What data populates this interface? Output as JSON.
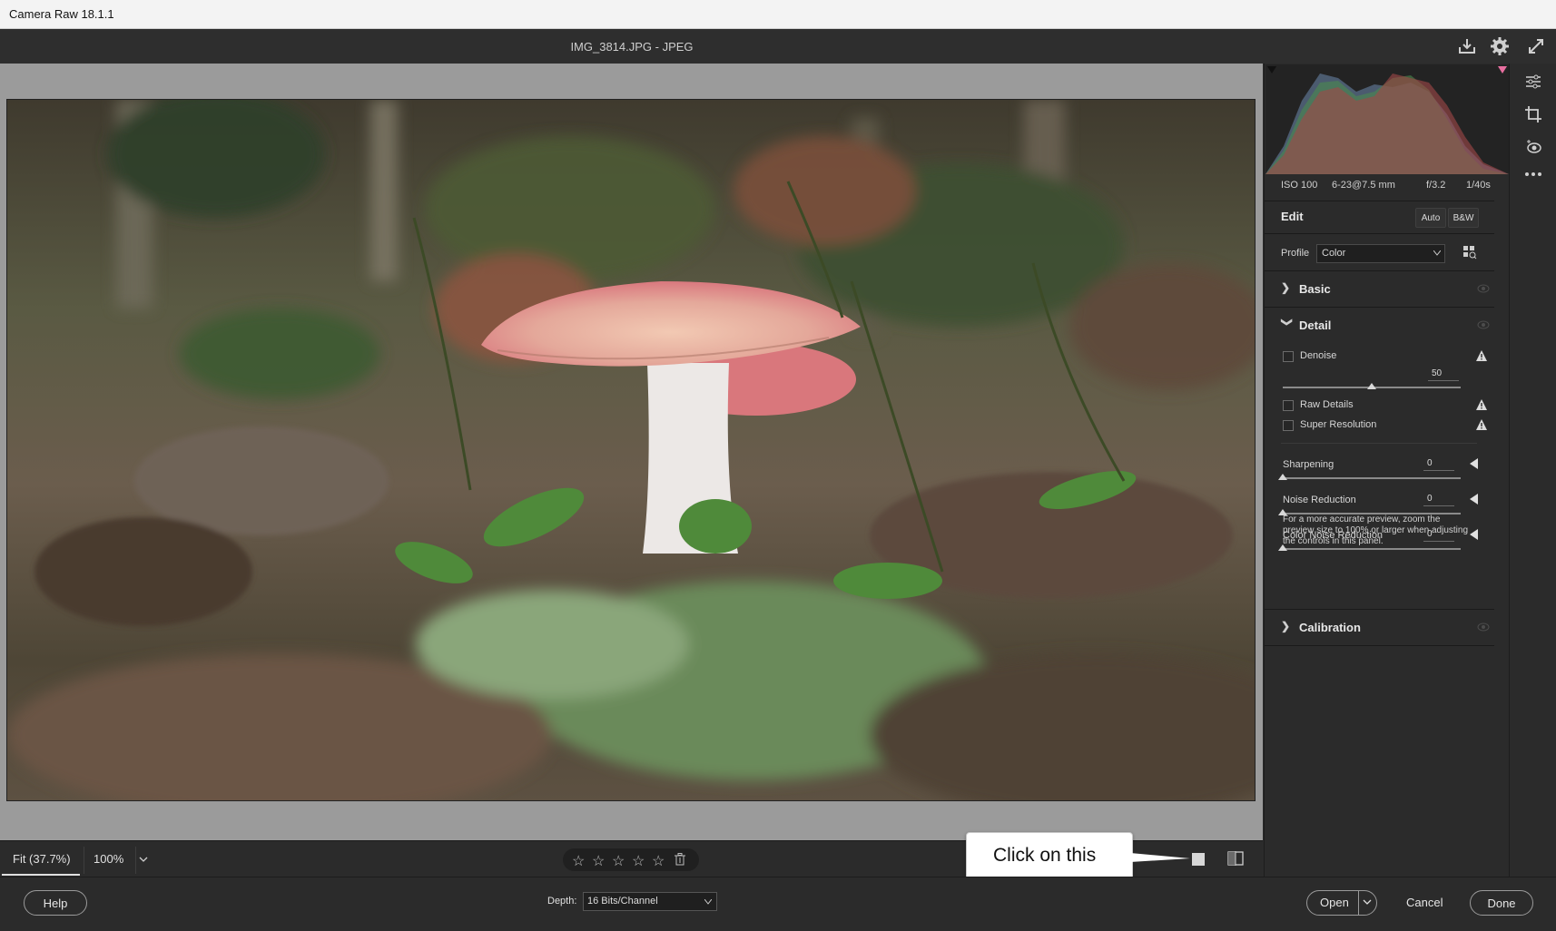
{
  "window": {
    "title": "Camera Raw 18.1.1"
  },
  "header": {
    "file_label": "IMG_3814.JPG  -  JPEG"
  },
  "exif": {
    "iso": "ISO 100",
    "lens": "6-23@7.5 mm",
    "aperture": "f/3.2",
    "shutter": "1/40s"
  },
  "edit": {
    "title": "Edit",
    "auto_label": "Auto",
    "bw_label": "B&W"
  },
  "profile": {
    "label": "Profile",
    "value": "Color"
  },
  "sections": {
    "basic": "Basic",
    "detail": "Detail",
    "calibration": "Calibration"
  },
  "detail": {
    "denoise_label": "Denoise",
    "denoise_value": "50",
    "denoise_level": 50,
    "raw_details_label": "Raw Details",
    "super_resolution_label": "Super Resolution",
    "sharpening_label": "Sharpening",
    "sharpening_value": "0",
    "noise_reduction_label": "Noise Reduction",
    "noise_reduction_value": "0",
    "color_noise_reduction_label": "Color Noise Reduction",
    "color_noise_reduction_value": "0",
    "note": "For a more accurate preview, zoom the preview size to 100% or larger when adjusting the controls in this panel."
  },
  "zoom": {
    "fit_label": "Fit (37.7%)",
    "zoom_label": "100%"
  },
  "rating": {
    "stars": 5,
    "rated": 0
  },
  "callout": {
    "text": "Click on this"
  },
  "footer": {
    "help_label": "Help",
    "depth_label": "Depth:",
    "depth_value": "16 Bits/Channel",
    "open_label": "Open",
    "cancel_label": "Cancel",
    "done_label": "Done"
  },
  "colors": {
    "ui_bg": "#2b2b2b",
    "preview_bg": "#9b9b9b",
    "mushroom_cap": "#d97a7e"
  }
}
